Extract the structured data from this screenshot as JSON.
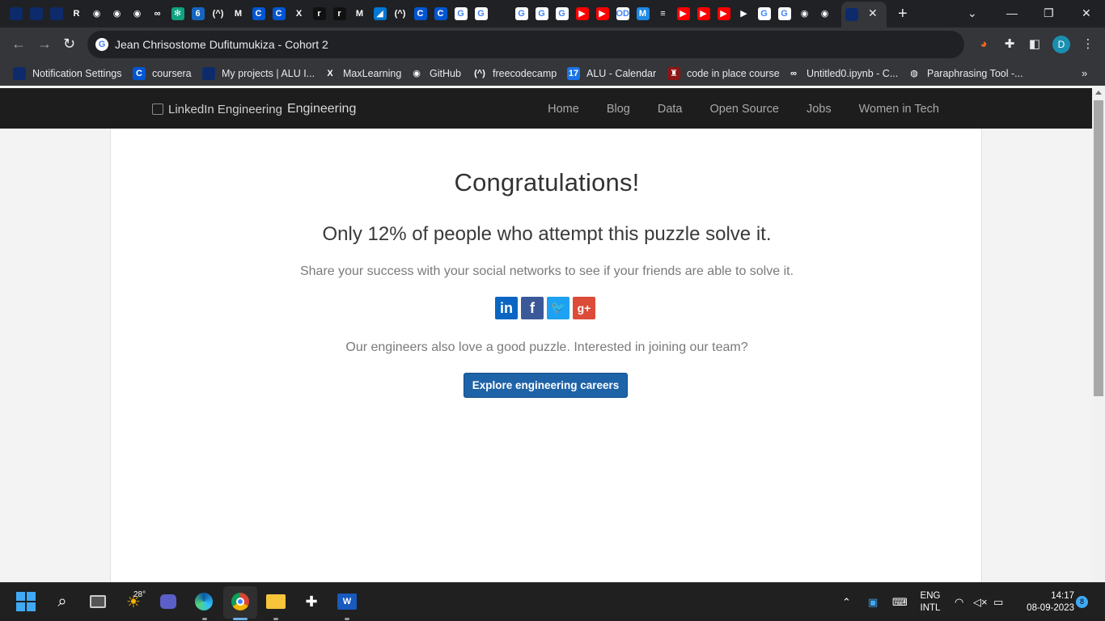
{
  "browser": {
    "active_tab_close": "✕",
    "new_tab": "+",
    "window_controls": {
      "minimize": "—",
      "maximize": "❐",
      "close": "✕"
    },
    "tab_favicons": [
      {
        "icon": "alu-icon",
        "glyph": "",
        "color": "#0d2a6b"
      },
      {
        "icon": "alu-icon",
        "glyph": "",
        "color": "#0d2a6b"
      },
      {
        "icon": "alu-icon",
        "glyph": "",
        "color": "#0d2a6b"
      },
      {
        "icon": "r-icon",
        "glyph": "R",
        "color": "#202124"
      },
      {
        "icon": "github-icon",
        "glyph": "◉",
        "color": "#202124"
      },
      {
        "icon": "github-icon",
        "glyph": "◉",
        "color": "#202124"
      },
      {
        "icon": "github-icon",
        "glyph": "◉",
        "color": "#202124"
      },
      {
        "icon": "meta-icon",
        "glyph": "∞",
        "color": "#202124"
      },
      {
        "icon": "chatgpt-icon",
        "glyph": "✻",
        "color": "#10a37f"
      },
      {
        "icon": "six-icon",
        "glyph": "6",
        "color": "#1565c0"
      },
      {
        "icon": "freecodecamp-icon",
        "glyph": "(^)",
        "color": "#202124"
      },
      {
        "icon": "gmail-icon",
        "glyph": "M",
        "color": "#202124"
      },
      {
        "icon": "coursera-icon",
        "glyph": "C",
        "color": "#0056d2"
      },
      {
        "icon": "coursera-icon",
        "glyph": "C",
        "color": "#0056d2"
      },
      {
        "icon": "x-icon",
        "glyph": "X",
        "color": "#202124"
      },
      {
        "icon": "r-icon",
        "glyph": "r",
        "color": "#111111"
      },
      {
        "icon": "r-icon",
        "glyph": "r",
        "color": "#111111"
      },
      {
        "icon": "m-icon",
        "glyph": "M",
        "color": "#202124"
      },
      {
        "icon": "azure-icon",
        "glyph": "◢",
        "color": "#0078d4"
      },
      {
        "icon": "freecodecamp-icon",
        "glyph": "(^)",
        "color": "#202124"
      },
      {
        "icon": "coursera-icon",
        "glyph": "C",
        "color": "#0056d2"
      },
      {
        "icon": "coursera-icon",
        "glyph": "C",
        "color": "#0056d2"
      },
      {
        "icon": "google-icon",
        "glyph": "G",
        "color": "#ffffff"
      },
      {
        "icon": "google-icon",
        "glyph": "G",
        "color": "#ffffff"
      },
      {
        "icon": "blank-icon",
        "glyph": "",
        "color": "#202124"
      },
      {
        "icon": "google-icon",
        "glyph": "G",
        "color": "#ffffff"
      },
      {
        "icon": "google-icon",
        "glyph": "G",
        "color": "#ffffff"
      },
      {
        "icon": "google-icon",
        "glyph": "G",
        "color": "#ffffff"
      },
      {
        "icon": "youtube-icon",
        "glyph": "▶",
        "color": "#ff0000"
      },
      {
        "icon": "youtube-icon",
        "glyph": "▶",
        "color": "#ff0000"
      },
      {
        "icon": "od-icon",
        "glyph": "OD",
        "color": "#ffffff"
      },
      {
        "icon": "m-icon",
        "glyph": "M",
        "color": "#1e88e5"
      },
      {
        "icon": "database-icon",
        "glyph": "≡",
        "color": "#202124"
      },
      {
        "icon": "youtube-icon",
        "glyph": "▶",
        "color": "#ff0000"
      },
      {
        "icon": "youtube-icon",
        "glyph": "▶",
        "color": "#ff0000"
      },
      {
        "icon": "youtube-icon",
        "glyph": "▶",
        "color": "#ff0000"
      },
      {
        "icon": "play-icon",
        "glyph": "▶",
        "color": "#202124"
      },
      {
        "icon": "google-icon",
        "glyph": "G",
        "color": "#ffffff"
      },
      {
        "icon": "google-icon",
        "glyph": "G",
        "color": "#ffffff"
      },
      {
        "icon": "github-icon",
        "glyph": "◉",
        "color": "#202124"
      },
      {
        "icon": "github-icon",
        "glyph": "◉",
        "color": "#202124"
      }
    ],
    "url": "Jean Chrisostome Dufitumukiza - Cohort 2",
    "profile_initial": "D"
  },
  "bookmarks": [
    {
      "label": "Notification Settings",
      "icon": "alu-icon",
      "glyph": "",
      "color": "#0d2a6b"
    },
    {
      "label": "coursera",
      "icon": "coursera-icon",
      "glyph": "C",
      "color": "#0056d2"
    },
    {
      "label": "My projects | ALU I...",
      "icon": "alu-icon",
      "glyph": "",
      "color": "#0d2a6b"
    },
    {
      "label": "MaxLearning",
      "icon": "x-icon",
      "glyph": "X",
      "color": "#35363a"
    },
    {
      "label": "GitHub",
      "icon": "github-icon",
      "glyph": "◉",
      "color": "#35363a"
    },
    {
      "label": "freecodecamp",
      "icon": "freecodecamp-icon",
      "glyph": "(^)",
      "color": "#35363a"
    },
    {
      "label": "ALU - Calendar",
      "icon": "calendar-icon",
      "glyph": "17",
      "color": "#1a73e8"
    },
    {
      "label": "code in place course",
      "icon": "stanford-icon",
      "glyph": "♜",
      "color": "#8c1515"
    },
    {
      "label": "Untitled0.ipynb - C...",
      "icon": "colab-icon",
      "glyph": "∞",
      "color": "#35363a"
    },
    {
      "label": "Paraphrasing Tool -...",
      "icon": "globe-icon",
      "glyph": "◍",
      "color": "#35363a"
    }
  ],
  "site": {
    "brand_alt": "LinkedIn Engineering",
    "brand_text": "Engineering",
    "menu": [
      "Home",
      "Blog",
      "Data",
      "Open Source",
      "Jobs",
      "Women in Tech"
    ],
    "heading": "Congratulations!",
    "stat": "Only 12% of people who attempt this puzzle solve it.",
    "share_text": "Share your success with your social networks to see if your friends are able to solve it.",
    "socials": [
      {
        "name": "linkedin",
        "glyph": "in",
        "color": "#0a66c2"
      },
      {
        "name": "facebook",
        "glyph": "f",
        "color": "#3b5998"
      },
      {
        "name": "twitter",
        "glyph": "🐦",
        "color": "#1da1f2"
      },
      {
        "name": "google-plus",
        "glyph": "g+",
        "color": "#dd4b39"
      }
    ],
    "join_text": "Our engineers also love a good puzzle. Interested in joining our team?",
    "careers_button": "Explore engineering careers"
  },
  "taskbar": {
    "weather_temp": "28°",
    "language": "ENG",
    "layout": "INTL",
    "time": "14:17",
    "date": "08-09-2023",
    "notifications": "8"
  }
}
